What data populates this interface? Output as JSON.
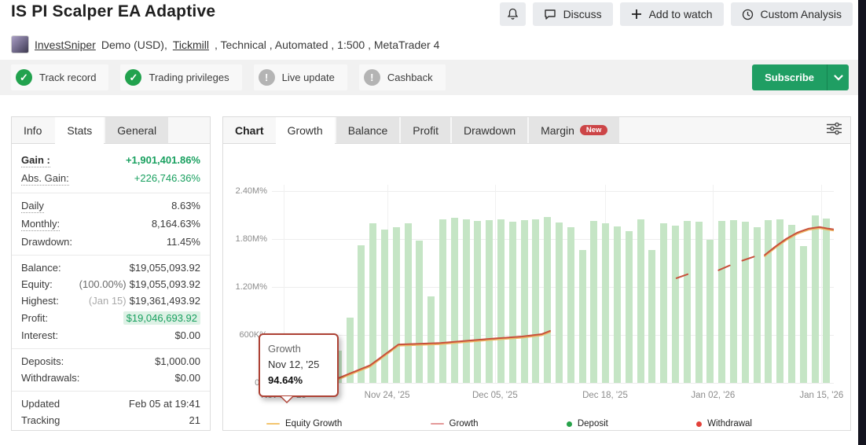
{
  "header": {
    "title": "IS PI Scalper EA Adaptive",
    "actions": [
      {
        "label": "Discuss",
        "icon": "speech-bubble"
      },
      {
        "label": "Add to watch",
        "icon": "plus"
      },
      {
        "label": "Custom Analysis",
        "icon": "clock"
      }
    ],
    "badges": [
      {
        "label": "Track record",
        "status": "verified"
      },
      {
        "label": "Trading privileges",
        "status": "verified"
      },
      {
        "label": "Live update",
        "status": "inactive"
      },
      {
        "label": "Cashback",
        "status": "inactive"
      }
    ],
    "subscribe_label": "Subscribe"
  },
  "account": {
    "user": "InvestSniper",
    "segment1": "Demo (USD),",
    "broker": "Tickmill",
    "segment2": ", Technical , Automated , 1:500 , MetaTrader 4"
  },
  "stats_panel": {
    "tabs": [
      {
        "label": "Info",
        "active": false
      },
      {
        "label": "Stats",
        "active": true
      },
      {
        "label": "General",
        "active": false
      }
    ],
    "sections": [
      {
        "rows": [
          {
            "label": "Gain :",
            "value": "+1,901,401.86%",
            "value_color": "green",
            "bold": true,
            "dotted": true
          },
          {
            "label": "Abs. Gain:",
            "value": "+226,746.36%",
            "value_color": "green",
            "dotted": true
          }
        ]
      },
      {
        "rows": [
          {
            "label": "Daily",
            "value": "8.63%",
            "dotted": true
          },
          {
            "label": "Monthly:",
            "value": "8,164.63%",
            "dotted": true
          },
          {
            "label": "Drawdown:",
            "value": "11.45%"
          }
        ]
      },
      {
        "rows": [
          {
            "label": "Balance:",
            "value": "$19,055,093.92"
          },
          {
            "label": "Equity:",
            "pre": "(100.00%)",
            "pre_color": "dim",
            "value": "$19,055,093.92"
          },
          {
            "label": "Highest:",
            "pre": "(Jan 15)",
            "pre_color": "gray",
            "value": "$19,361,493.92"
          },
          {
            "label": "Profit:",
            "value": "$19,046,693.92",
            "value_color": "green-hl"
          },
          {
            "label": "Interest:",
            "value": "$0.00"
          }
        ]
      },
      {
        "rows": [
          {
            "label": "Deposits:",
            "value": "$1,000.00"
          },
          {
            "label": "Withdrawals:",
            "value": "$0.00"
          }
        ]
      },
      {
        "rows": [
          {
            "label": "Updated",
            "value": "Feb 05 at 19:41"
          },
          {
            "label": "Tracking",
            "value": "21"
          }
        ]
      }
    ]
  },
  "chart_panel": {
    "section_label": "Chart",
    "tabs": [
      {
        "label": "Growth",
        "active": true
      },
      {
        "label": "Balance"
      },
      {
        "label": "Profit"
      },
      {
        "label": "Drawdown"
      },
      {
        "label": "Margin",
        "badge": "New"
      }
    ]
  },
  "chart_data": {
    "type": "bar+line",
    "title": "Growth",
    "y_unit": "percent (M% = million percent)",
    "ylim": [
      0,
      2.4
    ],
    "grid": true,
    "y_ticks": [
      {
        "label": "2.40M%",
        "value": 2.4
      },
      {
        "label": "1.80M%",
        "value": 1.8
      },
      {
        "label": "1.20M%",
        "value": 1.2
      },
      {
        "label": "600K%",
        "value": 0.6
      },
      {
        "label": "0%",
        "value": 0
      }
    ],
    "x_ticks": [
      {
        "label": "Nov 12, '25",
        "frac": 0.021
      },
      {
        "label": "Nov 24, '25",
        "frac": 0.205
      },
      {
        "label": "Dec 05, '25",
        "frac": 0.397
      },
      {
        "label": "Dec 18, '25",
        "frac": 0.593
      },
      {
        "label": "Jan 02, '26",
        "frac": 0.785
      },
      {
        "label": "Jan 15, '26",
        "frac": 0.978
      }
    ],
    "bars": {
      "name": "Growth (daily, M%)",
      "color": "#c5e5c5",
      "values_m_pct": [
        0.15,
        0.4,
        0.82,
        1.72,
        2.0,
        1.92,
        1.95,
        2.0,
        1.78,
        1.08,
        2.05,
        2.07,
        2.05,
        2.03,
        2.04,
        2.05,
        2.02,
        2.04,
        2.05,
        2.08,
        2.01,
        1.95,
        1.66,
        2.03,
        2.0,
        1.96,
        1.9,
        2.05,
        1.66,
        2.0,
        1.97,
        2.03,
        2.02,
        1.79,
        2.03,
        2.04,
        2.02,
        1.95,
        2.04,
        2.05,
        1.98,
        1.71,
        2.1,
        2.06
      ]
    },
    "growth_line": {
      "name": "Growth",
      "color": "#c7503b",
      "solid": [
        [
          [
            0.014,
            0.03
          ],
          [
            0.115,
            0.05
          ],
          [
            0.175,
            0.22
          ],
          [
            0.225,
            0.48
          ],
          [
            0.3,
            0.5
          ],
          [
            0.385,
            0.55
          ],
          [
            0.445,
            0.58
          ],
          [
            0.48,
            0.61
          ],
          [
            0.495,
            0.65
          ]
        ],
        [
          [
            0.877,
            1.6
          ],
          [
            0.895,
            1.7
          ],
          [
            0.915,
            1.8
          ],
          [
            0.935,
            1.88
          ],
          [
            0.955,
            1.93
          ],
          [
            0.975,
            1.95
          ],
          [
            0.99,
            1.93
          ],
          [
            1.0,
            1.92
          ]
        ]
      ],
      "dashed": [
        [
          [
            0.72,
            1.31
          ],
          [
            0.74,
            1.36
          ]
        ],
        [
          [
            0.795,
            1.41
          ],
          [
            0.815,
            1.47
          ]
        ],
        [
          [
            0.837,
            1.53
          ],
          [
            0.858,
            1.58
          ]
        ]
      ]
    },
    "equity_line": {
      "name": "Equity Growth",
      "color": "#edb766"
    },
    "legend": [
      {
        "label": "Equity Growth",
        "marker": "line",
        "color": "#f3c56f"
      },
      {
        "label": "Growth",
        "marker": "line",
        "color": "#e49999"
      },
      {
        "label": "Deposit",
        "marker": "dot",
        "color": "#27a24a"
      },
      {
        "label": "Withdrawal",
        "marker": "dot",
        "color": "#e2413a"
      }
    ],
    "tooltip": {
      "series": "Growth",
      "date": "Nov 12, '25",
      "value": "94.64%"
    }
  }
}
